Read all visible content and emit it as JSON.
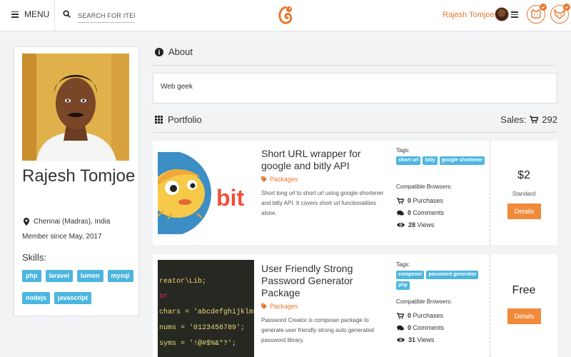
{
  "header": {
    "menu_label": "MENU",
    "search_placeholder": "SEARCH FOR ITEMS",
    "user_name": "Rajesh Tomjoe"
  },
  "profile": {
    "name": "Rajesh Tomjoe",
    "location": "Chennai (Madras), India",
    "member_since": "Member since May, 2017",
    "skills_title": "Skills:",
    "skills": [
      "php",
      "laravel",
      "lumen",
      "mysql",
      "nodejs",
      "javascript"
    ]
  },
  "about": {
    "title": "About",
    "text": "Web geek"
  },
  "portfolio": {
    "title": "Portfolio",
    "sales_label": "Sales:",
    "sales_count": "292",
    "items": [
      {
        "title": "Short URL wrapper for google and bitly API",
        "category": "Packages",
        "description": "Short long url to short url using google shortener and bitly API. It covers short url functionalities alone.",
        "tags_label": "Tags:",
        "tags": [
          "short url",
          "bitly",
          "google shortener"
        ],
        "browsers_label": "Compatible Browsers:",
        "purchases": "0",
        "purchases_label": "Purchases",
        "comments": "0",
        "comments_label": "Comments",
        "views": "28",
        "views_label": "Views",
        "price": "$2",
        "license": "Standard",
        "details_label": "Details",
        "thumb_text": "bit"
      },
      {
        "title": "User Friendly Strong Password Generator Package",
        "category": "Packages",
        "description": "Password Creator is composer package to generate user friendly strong auto generated password library.",
        "tags_label": "Tags:",
        "tags": [
          "composer",
          "password generator",
          "php"
        ],
        "browsers_label": "Compatible Browsers:",
        "purchases": "0",
        "purchases_label": "Purchases",
        "comments": "0",
        "comments_label": "Comments",
        "views": "31",
        "views_label": "Views",
        "price": "Free",
        "license": "",
        "details_label": "Details",
        "code_lines": [
          "reator\\Lib;",
          "or",
          "chars = 'abcdefghijklmnop",
          "nums = '0123456789';",
          "syms = '!@#$%&*?';"
        ]
      }
    ]
  },
  "colors": {
    "accent": "#e8772e",
    "button": "#f08a3a",
    "tag": "#4cb6df"
  }
}
